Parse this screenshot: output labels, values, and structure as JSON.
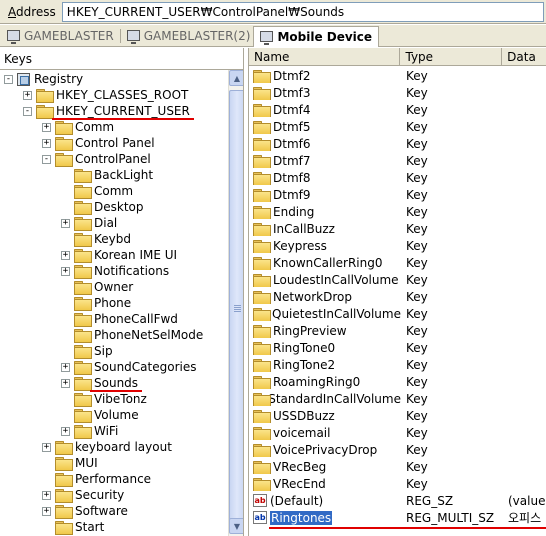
{
  "address": {
    "label_prefix": "A",
    "label_rest": "ddress",
    "path": "HKEY_CURRENT_USER₩ControlPanel₩Sounds"
  },
  "tabs": [
    {
      "label": "GAMEBLASTER"
    },
    {
      "label": "GAMEBLASTER(2)"
    },
    {
      "label": "Mobile Device"
    }
  ],
  "left": {
    "header": "Keys",
    "tree": [
      {
        "label": "Registry",
        "level": 0,
        "exp": "-",
        "icon": "registry"
      },
      {
        "label": "HKEY_CLASSES_ROOT",
        "level": 1,
        "exp": "+",
        "icon": "folder"
      },
      {
        "label": "HKEY_CURRENT_USER",
        "level": 1,
        "exp": "-",
        "icon": "folder"
      },
      {
        "label": "Comm",
        "level": 2,
        "exp": "+",
        "icon": "folder"
      },
      {
        "label": "Control Panel",
        "level": 2,
        "exp": "+",
        "icon": "folder"
      },
      {
        "label": "ControlPanel",
        "level": 2,
        "exp": "-",
        "icon": "folder"
      },
      {
        "label": "BackLight",
        "level": 3,
        "exp": "",
        "icon": "folder"
      },
      {
        "label": "Comm",
        "level": 3,
        "exp": "",
        "icon": "folder"
      },
      {
        "label": "Desktop",
        "level": 3,
        "exp": "",
        "icon": "folder"
      },
      {
        "label": "Dial",
        "level": 3,
        "exp": "+",
        "icon": "folder"
      },
      {
        "label": "Keybd",
        "level": 3,
        "exp": "",
        "icon": "folder"
      },
      {
        "label": "Korean IME UI",
        "level": 3,
        "exp": "+",
        "icon": "folder"
      },
      {
        "label": "Notifications",
        "level": 3,
        "exp": "+",
        "icon": "folder"
      },
      {
        "label": "Owner",
        "level": 3,
        "exp": "",
        "icon": "folder"
      },
      {
        "label": "Phone",
        "level": 3,
        "exp": "",
        "icon": "folder"
      },
      {
        "label": "PhoneCallFwd",
        "level": 3,
        "exp": "",
        "icon": "folder"
      },
      {
        "label": "PhoneNetSelMode",
        "level": 3,
        "exp": "",
        "icon": "folder"
      },
      {
        "label": "Sip",
        "level": 3,
        "exp": "",
        "icon": "folder"
      },
      {
        "label": "SoundCategories",
        "level": 3,
        "exp": "+",
        "icon": "folder"
      },
      {
        "label": "Sounds",
        "level": 3,
        "exp": "+",
        "icon": "folder"
      },
      {
        "label": "VibeTonz",
        "level": 3,
        "exp": "",
        "icon": "folder"
      },
      {
        "label": "Volume",
        "level": 3,
        "exp": "",
        "icon": "folder"
      },
      {
        "label": "WiFi",
        "level": 3,
        "exp": "+",
        "icon": "folder"
      },
      {
        "label": "keyboard layout",
        "level": 2,
        "exp": "+",
        "icon": "folder"
      },
      {
        "label": "MUI",
        "level": 2,
        "exp": "",
        "icon": "folder"
      },
      {
        "label": "Performance",
        "level": 2,
        "exp": "",
        "icon": "folder"
      },
      {
        "label": "Security",
        "level": 2,
        "exp": "+",
        "icon": "folder"
      },
      {
        "label": "Software",
        "level": 2,
        "exp": "+",
        "icon": "folder"
      },
      {
        "label": "Start",
        "level": 2,
        "exp": "",
        "icon": "folder"
      }
    ]
  },
  "right": {
    "columns": {
      "name": "Name",
      "type": "Type",
      "data": "Data"
    },
    "rows": [
      {
        "name": "Dtmf2",
        "type": "Key",
        "data": "",
        "icon": "folder"
      },
      {
        "name": "Dtmf3",
        "type": "Key",
        "data": "",
        "icon": "folder"
      },
      {
        "name": "Dtmf4",
        "type": "Key",
        "data": "",
        "icon": "folder"
      },
      {
        "name": "Dtmf5",
        "type": "Key",
        "data": "",
        "icon": "folder"
      },
      {
        "name": "Dtmf6",
        "type": "Key",
        "data": "",
        "icon": "folder"
      },
      {
        "name": "Dtmf7",
        "type": "Key",
        "data": "",
        "icon": "folder"
      },
      {
        "name": "Dtmf8",
        "type": "Key",
        "data": "",
        "icon": "folder"
      },
      {
        "name": "Dtmf9",
        "type": "Key",
        "data": "",
        "icon": "folder"
      },
      {
        "name": "Ending",
        "type": "Key",
        "data": "",
        "icon": "folder"
      },
      {
        "name": "InCallBuzz",
        "type": "Key",
        "data": "",
        "icon": "folder"
      },
      {
        "name": "Keypress",
        "type": "Key",
        "data": "",
        "icon": "folder"
      },
      {
        "name": "KnownCallerRing0",
        "type": "Key",
        "data": "",
        "icon": "folder"
      },
      {
        "name": "LoudestInCallVolume",
        "type": "Key",
        "data": "",
        "icon": "folder"
      },
      {
        "name": "NetworkDrop",
        "type": "Key",
        "data": "",
        "icon": "folder"
      },
      {
        "name": "QuietestInCallVolume",
        "type": "Key",
        "data": "",
        "icon": "folder"
      },
      {
        "name": "RingPreview",
        "type": "Key",
        "data": "",
        "icon": "folder"
      },
      {
        "name": "RingTone0",
        "type": "Key",
        "data": "",
        "icon": "folder"
      },
      {
        "name": "RingTone2",
        "type": "Key",
        "data": "",
        "icon": "folder"
      },
      {
        "name": "RoamingRing0",
        "type": "Key",
        "data": "",
        "icon": "folder"
      },
      {
        "name": "StandardInCallVolume",
        "type": "Key",
        "data": "",
        "icon": "folder"
      },
      {
        "name": "USSDBuzz",
        "type": "Key",
        "data": "",
        "icon": "folder"
      },
      {
        "name": "voicemail",
        "type": "Key",
        "data": "",
        "icon": "folder"
      },
      {
        "name": "VoicePrivacyDrop",
        "type": "Key",
        "data": "",
        "icon": "folder"
      },
      {
        "name": "VRecBeg",
        "type": "Key",
        "data": "",
        "icon": "folder"
      },
      {
        "name": "VRecEnd",
        "type": "Key",
        "data": "",
        "icon": "folder"
      },
      {
        "name": "(Default)",
        "type": "REG_SZ",
        "data": "(value",
        "icon": "ab"
      },
      {
        "name": "Ringtones",
        "type": "REG_MULTI_SZ",
        "data": "오피스",
        "icon": "ab-blue",
        "selected": true
      }
    ]
  },
  "colors": {
    "highlight": "#316ac5",
    "underline": "#e00000",
    "chrome": "#ece9d8"
  }
}
